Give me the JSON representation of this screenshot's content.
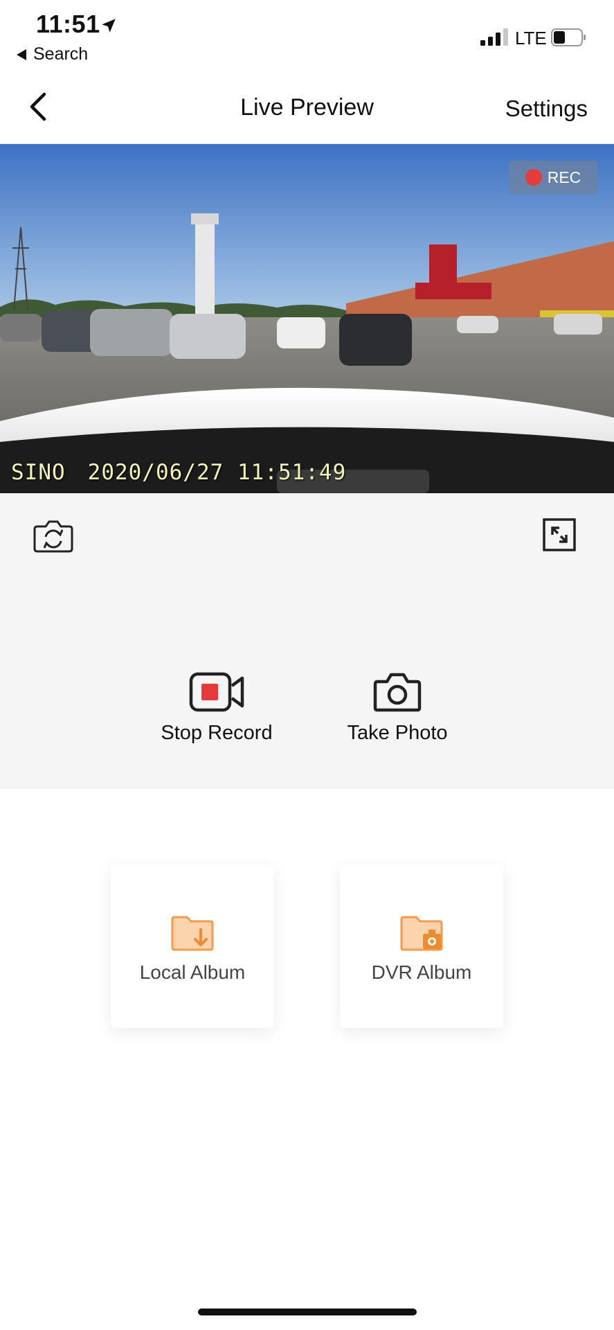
{
  "status_bar": {
    "time": "11:51",
    "back_app_label": "Search",
    "network": "LTE"
  },
  "nav": {
    "title": "Live Preview",
    "settings_label": "Settings"
  },
  "preview": {
    "rec_label": "REC",
    "osd_brand": "SINO",
    "osd_timestamp": "2020/06/27 11:51:49"
  },
  "controls": {
    "stop_record_label": "Stop Record",
    "take_photo_label": "Take Photo"
  },
  "albums": {
    "local_label": "Local Album",
    "dvr_label": "DVR Album"
  },
  "colors": {
    "accent_record": "#e53b3b",
    "album_orange": "#f39a4c",
    "panel_bg": "#f5f5f5"
  }
}
